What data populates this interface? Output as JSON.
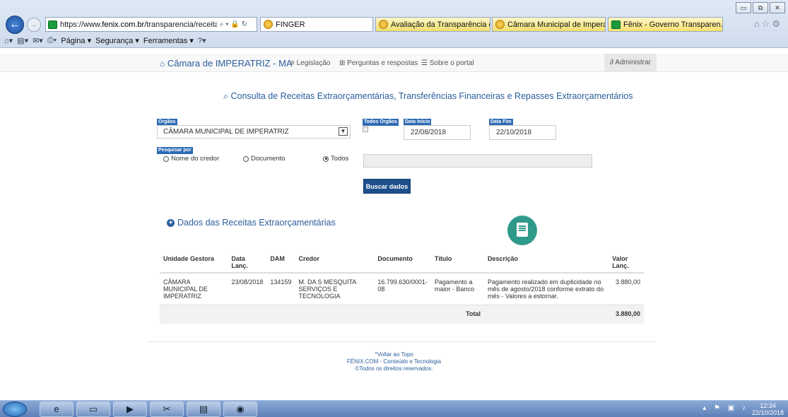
{
  "browser": {
    "url_prefix": "https://www.",
    "url_domain": "fenix.com.br",
    "url_rest": "/transparencia/receitas_e",
    "address_icons": "⌕ ▾ 🔒 ↻",
    "tabs": [
      {
        "title": "FINGER"
      },
      {
        "title": "Avaliação da Transparência do..."
      },
      {
        "title": "Câmara Municipal de Imperatr..."
      },
      {
        "title": "Fênix - Governo Transparen..."
      }
    ],
    "tab_close": "✕",
    "window_buttons": [
      "▭",
      "⧉",
      "✕"
    ],
    "home_tools": "⌂☆⚙",
    "commands": {
      "pagina": "Página ▾",
      "seguranca": "Segurança ▾",
      "ferramentas": "Ferramentas ▾"
    }
  },
  "site_nav": {
    "brand": "Câmara de IMPERATRIZ - MA",
    "legislacao": "Legislação",
    "perguntas": "Perguntas e respostas",
    "sobre": "Sobre o portal",
    "administrar": "Administrar"
  },
  "page_title": "Consulta de Receitas Extraorçamentárias, Transferências Financeiras e Repasses Extraorçamentários",
  "form": {
    "orgaos_label": "Órgãos",
    "orgao_value": "CÂMARA MUNICIPAL DE IMPERATRIZ",
    "todos_orgaos_label": "Todos Órgãos",
    "data_inicio_label": "Data Início",
    "data_inicio": "22/08/2018",
    "data_fim_label": "Data Fim",
    "data_fim": "22/10/2018",
    "pesquisar_por_label": "Pesquisar por",
    "radio_credor": "Nome do credor",
    "radio_documento": "Documento",
    "radio_todos": "Todos",
    "buscar": "Buscar dados"
  },
  "section_title": "Dados das Receitas Extraorçamentárias",
  "table": {
    "headers": {
      "unidade": "Unidade Gestora",
      "data": "Data Lanç.",
      "dam": "DAM",
      "credor": "Credor",
      "documento": "Documento",
      "titulo": "Título",
      "descricao": "Descrição",
      "valor": "Valor Lanç."
    },
    "rows": [
      {
        "unidade": "CÂMARA MUNICIPAL DE IMPERATRIZ",
        "data": "23/08/2018",
        "dam": "134159",
        "credor": "M. DA S MESQUITA SERVIÇOS E TECNOLOGIA",
        "documento": "16.799.630/0001-08",
        "titulo": "Pagamento a maior - Banco",
        "descricao": "Pagamento realizado em duplicidade no mês de agosto/2018 conforme extrato do mês - Valores a estornar.",
        "valor": "3.880,00"
      }
    ],
    "total_label": "Total",
    "total_value": "3.880,00"
  },
  "footer": {
    "voltar": "Voltar ao Topo",
    "empresa": "FÊNIX.COM - Conteúdo e Tecnologia",
    "direitos": "©Todos os direitos reservados."
  },
  "taskbar": {
    "time": "12:34",
    "date": "22/10/2018"
  }
}
